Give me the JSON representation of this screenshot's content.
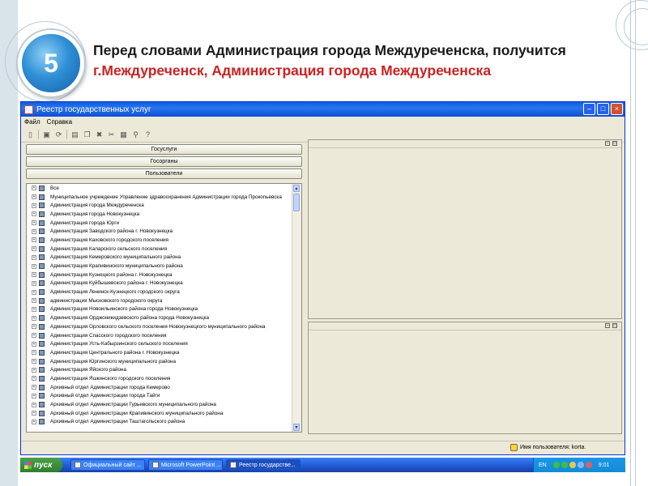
{
  "slide": {
    "step_number": "5",
    "heading_part1": "Перед словами Администрация города Междуреченска, получится ",
    "heading_highlight": "г.Междуреченск, Администрация города Междуреченска"
  },
  "window": {
    "title": "Реестр государственных услуг",
    "menu": [
      "Файл",
      "Справка"
    ],
    "toolbar_icons": [
      "new-icon",
      "save-icon",
      "reload-icon",
      "print-icon",
      "copy-icon",
      "delete-icon",
      "cut-icon",
      "paste-icon",
      "find-icon",
      "help-icon"
    ],
    "nav_buttons": [
      "Госуслуги",
      "Госорганы",
      "Пользователи"
    ],
    "tree_items": [
      "Все",
      "Муниципальное учреждение  Управление здравоохранения Администрации города Прокопьевска",
      "Администрация города Междуреченска",
      "Администрация города Новокузнецка",
      "Администрация города Юрги",
      "Администрация Заводского района г. Новокузнецка",
      "Администрация Каховского городского поселения",
      "Администрация Каларского  сельского поселения",
      "Администрация Кемеровского муниципального района",
      "Администрация Крапивинского муниципального района",
      "Администрация Кузнецкого района г. Новокузнецка",
      "Администрация Куйбышевского района г. Новокузнецка",
      "Администрация Ленинск-Кузнецкого городского округа",
      "администрация Мысковского городского округа",
      "Администрация Новоильинского района города Новокузнецка",
      "Администрация Орджоникидзевского района города Новокузнецка",
      "Администрация Орловского сельского поселения Новокузнецкого муниципального района",
      "Администрация Спасского  городского  поселения",
      "Администрация Усть-Кабырзинского сельского поселения",
      "Администрация Центрального района г. Новокузнецка",
      "Администрация Юргинского муниципального района",
      "Администрация Яйского района",
      "Администрация Яшкинского городского поселения",
      "Архивный отдел Администрации города Кемерово",
      "Архивный отдел Администрации города Тайги",
      "Архивный отдел Администрации Гурьевского муниципального района",
      "Архивный отдел Администрации Крапивинского муниципального района",
      "Архивный отдел Администрации Таштагольского района"
    ],
    "status_user": "Имя пользователя: korta."
  },
  "taskbar": {
    "start_label": "пуск",
    "tasks": [
      "Официальный сайт ...",
      "Microsoft PowerPoint ...",
      "Реестр государстве..."
    ],
    "lang": "EN",
    "clock": "9:01"
  }
}
